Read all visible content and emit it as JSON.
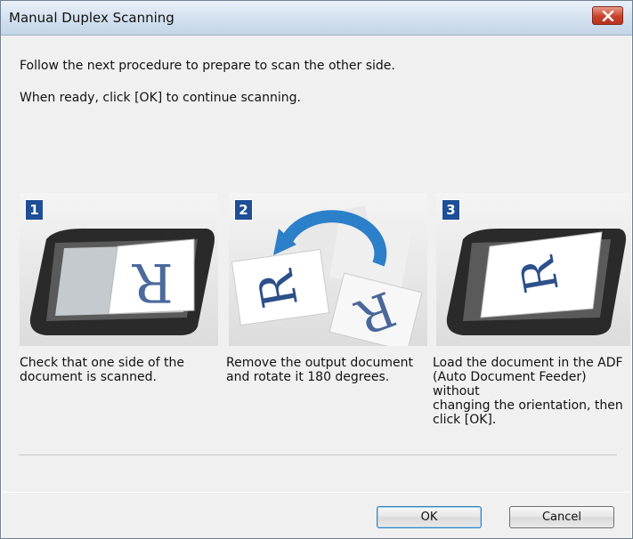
{
  "dialog": {
    "title": "Manual Duplex Scanning",
    "message_line1": "Follow the next procedure to prepare to scan the other side.",
    "message_line2": "When ready, click [OK] to continue scanning."
  },
  "steps": [
    {
      "number": "1",
      "caption": "Check that one side of the\ndocument is scanned."
    },
    {
      "number": "2",
      "caption": "Remove the output document\nand rotate it 180 degrees."
    },
    {
      "number": "3",
      "caption": "Load the document in the ADF\n(Auto Document Feeder) without\nchanging the orientation, then\nclick [OK]."
    }
  ],
  "page_glyph": "R",
  "buttons": {
    "ok": "OK",
    "cancel": "Cancel"
  },
  "colors": {
    "step_badge": "#1d4e96",
    "accent_arrow": "#2c7fc9",
    "letter": "#2d4f8a"
  }
}
